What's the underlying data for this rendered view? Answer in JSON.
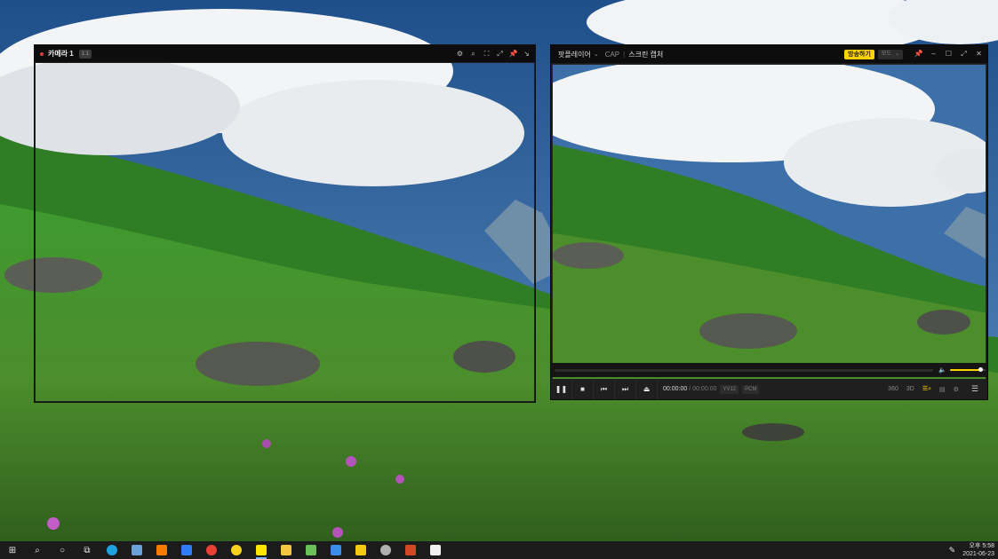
{
  "camera_window": {
    "title": "카메라 1",
    "badge": "1:1",
    "toolbar_icons": [
      "gear-icon",
      "search-icon",
      "fit-icon",
      "fullscreen-icon",
      "pin-icon",
      "collapse-icon"
    ]
  },
  "player_window": {
    "app_name": "팟플레이어",
    "cap_label": "CAP",
    "separator": "|",
    "mode_label": "스크린 캡처",
    "broadcast_button": "방송하기",
    "mode_select": "모드",
    "time_current": "00:00:00",
    "time_separator": "/",
    "time_total": "00:00:00",
    "video_codec": "YV12",
    "audio_codec": "PCM",
    "volume_level": 0.85,
    "right_labels": [
      "360",
      "3D"
    ]
  },
  "taskbar": {
    "apps": [
      {
        "name": "edge",
        "color": "#1fa3e0"
      },
      {
        "name": "paint",
        "color": "#6aa0d8"
      },
      {
        "name": "sublime",
        "color": "#f57c00"
      },
      {
        "name": "todo",
        "color": "#2f7bf0"
      },
      {
        "name": "chrome",
        "color": "#e84235"
      },
      {
        "name": "kakaotalk-pc",
        "color": "#f7d21c"
      },
      {
        "name": "kakaotalk",
        "color": "#fee500"
      },
      {
        "name": "explorer",
        "color": "#f4c542"
      },
      {
        "name": "notepad",
        "color": "#6bbf59"
      },
      {
        "name": "photos",
        "color": "#3b8ee8"
      },
      {
        "name": "sticky",
        "color": "#f2c811"
      },
      {
        "name": "paint3d",
        "color": "#b0b0b0"
      },
      {
        "name": "powerpoint",
        "color": "#d24726"
      },
      {
        "name": "store",
        "color": "#f0f0f0"
      }
    ],
    "clock_time": "오후 5:58",
    "clock_date": "2021-06-23"
  }
}
